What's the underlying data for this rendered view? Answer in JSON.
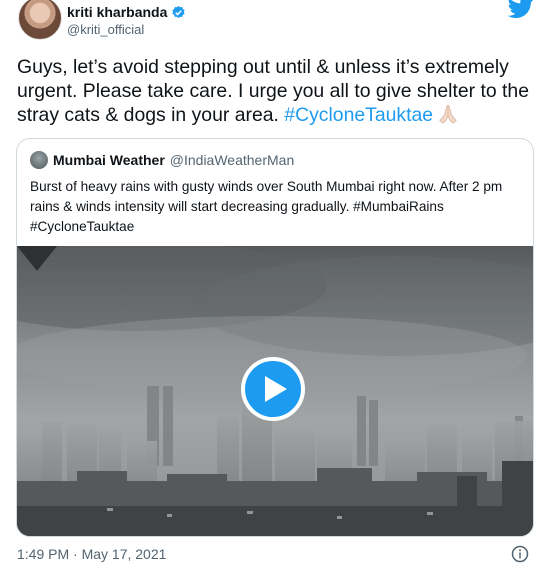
{
  "author": {
    "name": "kriti kharbanda",
    "handle": "@kriti_official",
    "verified": true
  },
  "tweet": {
    "text": "Guys, let’s avoid stepping out until & unless it’s extremely urgent. Please take care. I urge you all to give shelter to the stray cats & dogs in your area. ",
    "hashtag": "#CycloneTauktae",
    "emoji": "folded-hands"
  },
  "quoted": {
    "name": "Mumbai Weather",
    "handle": "@IndiaWeatherMan",
    "text": "Burst of heavy rains with gusty winds over South Mumbai right now. After 2 pm rains & winds intensity will start decreasing gradually. #MumbaiRains #CycloneTauktae",
    "media": {
      "type": "video",
      "description_icon": "play-icon"
    }
  },
  "footer": {
    "timestamp": "1:49 PM · May 17, 2021"
  },
  "icons": [
    "twitter-bird-icon",
    "verified-badge-icon",
    "play-icon",
    "info-icon"
  ],
  "colors": {
    "accent": "#1d9bf0",
    "text": "#0f1419",
    "secondary": "#536471",
    "border": "#cfd9de"
  }
}
